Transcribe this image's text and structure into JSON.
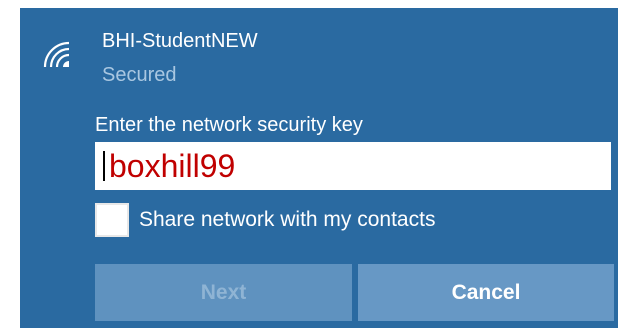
{
  "network": {
    "ssid": "BHI-StudentNEW",
    "status": "Secured",
    "icon": "wifi-icon"
  },
  "form": {
    "prompt": "Enter the network security key",
    "key_value": "boxhill99",
    "share_label": "Share network with my contacts",
    "share_checked": false
  },
  "buttons": {
    "next_label": "Next",
    "next_enabled": false,
    "cancel_label": "Cancel"
  },
  "colors": {
    "panel_bg": "#2a6aa1",
    "input_text": "#c00000",
    "secondary_text": "#a9c7e1",
    "button_bg": "#6798c5"
  }
}
